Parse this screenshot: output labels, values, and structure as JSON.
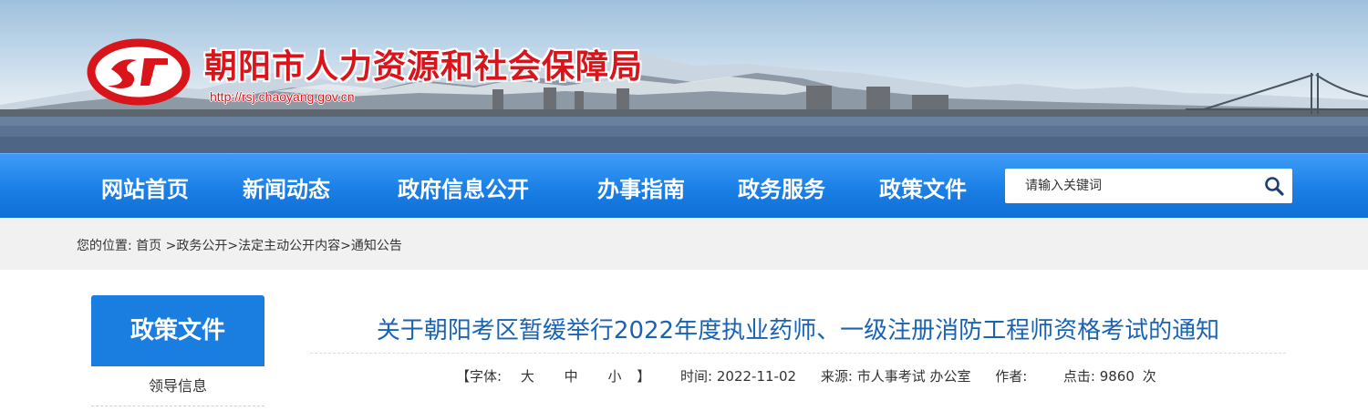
{
  "header": {
    "title": "朝阳市人力资源和社会保障局",
    "url": "http://rsj.chaoyang.gov.cn",
    "brand_red": "#d9141b"
  },
  "nav": {
    "items": [
      "网站首页",
      "新闻动态",
      "政府信息公开",
      "办事指南",
      "政务服务",
      "政策文件"
    ],
    "search_placeholder": "请输入关键词",
    "search_icon": "search-icon",
    "color": "#1a7fe6"
  },
  "breadcrumb": {
    "prefix": "您的位置:",
    "items": [
      "首页",
      " >政务公开",
      ">法定主动公开内容",
      ">通知公告"
    ]
  },
  "sidebar": {
    "heading": "政策文件",
    "items": [
      "领导信息"
    ]
  },
  "article": {
    "title": "关于朝阳考区暂缓举行2022年度执业药师、一级注册消防工程师资格考试的通知",
    "font_label": "【字体:",
    "font_large": "大",
    "font_medium": "中",
    "font_small": "小",
    "font_close": "】",
    "time_label": "时间:",
    "time": "2022-11-02",
    "source_label": "来源:",
    "source": "市人事考试 办公室",
    "author_label": "作者:",
    "author": "",
    "clicks_label": "点击:",
    "clicks": "9860",
    "clicks_unit": "次"
  }
}
